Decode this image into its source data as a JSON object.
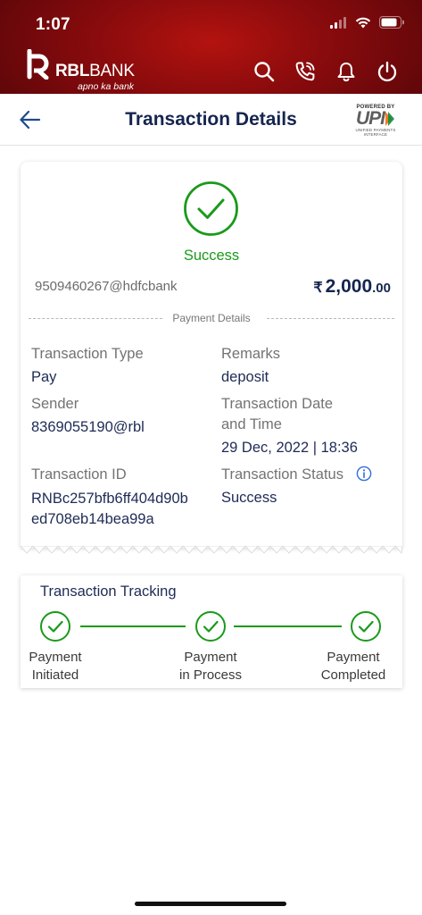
{
  "status_bar": {
    "time": "1:07"
  },
  "brand": {
    "name_bold": "RBL",
    "name_light": "BANK",
    "tagline": "apno ka bank"
  },
  "header_actions": [
    "search-icon",
    "phone-icon",
    "bell-icon",
    "power-icon"
  ],
  "title_bar": {
    "title": "Transaction Details",
    "upi": {
      "powered_by": "POWERED BY",
      "mark": "UPI",
      "subtitle": "UNIFIED PAYMENTS INTERFACE"
    }
  },
  "transaction": {
    "status": "Success",
    "payee_vpa": "9509460267@hdfcbank",
    "amount": {
      "currency_symbol": "₹",
      "whole": "2,000",
      "decimal": ".00"
    },
    "section_label": "Payment Details",
    "fields": {
      "type": {
        "label": "Transaction Type",
        "value": "Pay"
      },
      "remarks": {
        "label": "Remarks",
        "value": "deposit"
      },
      "sender": {
        "label": "Sender",
        "value": "8369055190@rbl"
      },
      "date": {
        "label_line1": "Transaction Date",
        "label_line2": "and Time",
        "value": "29 Dec, 2022 | 18:36"
      },
      "id": {
        "label": "Transaction ID",
        "value_line1": "RNBc257bfb6ff404d90b",
        "value_line2": "ed708eb14bea99a"
      },
      "status": {
        "label": "Transaction Status",
        "value": "Success"
      }
    }
  },
  "tracking": {
    "title": "Transaction Tracking",
    "steps": [
      {
        "line1": "Payment",
        "line2": "Initiated"
      },
      {
        "line1": "Payment",
        "line2": "in Process"
      },
      {
        "line1": "Payment",
        "line2": "Completed"
      }
    ]
  },
  "colors": {
    "header": "#8a0b0d",
    "success": "#1a9a1a",
    "navy": "#15254f",
    "info": "#2e6fd8"
  }
}
